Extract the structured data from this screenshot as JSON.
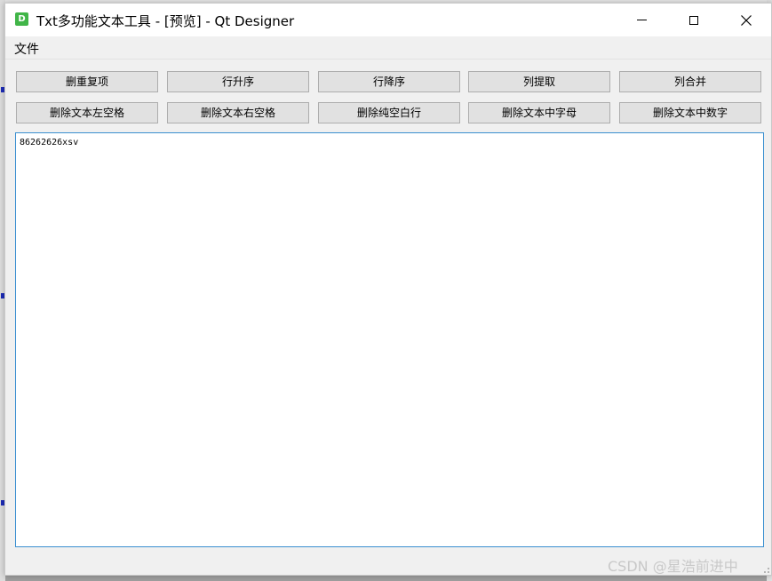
{
  "window": {
    "title": "Txt多功能文本工具 - [预览] - Qt Designer",
    "icon_letter": "D",
    "icon_color": "#41b548"
  },
  "window_controls": {
    "minimize_icon": "minimize-icon",
    "maximize_icon": "maximize-icon",
    "close_icon": "close-icon",
    "close_glyph": "✕"
  },
  "menubar": {
    "items": [
      {
        "label": "文件"
      }
    ]
  },
  "toolbar": {
    "row1": [
      {
        "label": "删重复项"
      },
      {
        "label": "行升序"
      },
      {
        "label": "行降序"
      },
      {
        "label": "列提取"
      },
      {
        "label": "列合并"
      }
    ],
    "row2": [
      {
        "label": "删除文本左空格"
      },
      {
        "label": "删除文本右空格"
      },
      {
        "label": "删除纯空白行"
      },
      {
        "label": "删除文本中字母"
      },
      {
        "label": "删除文本中数字"
      }
    ]
  },
  "editor": {
    "content": "86262626xsv",
    "border_color": "#3a8fd0"
  },
  "watermark": {
    "text": "CSDN @星浩前进中"
  }
}
